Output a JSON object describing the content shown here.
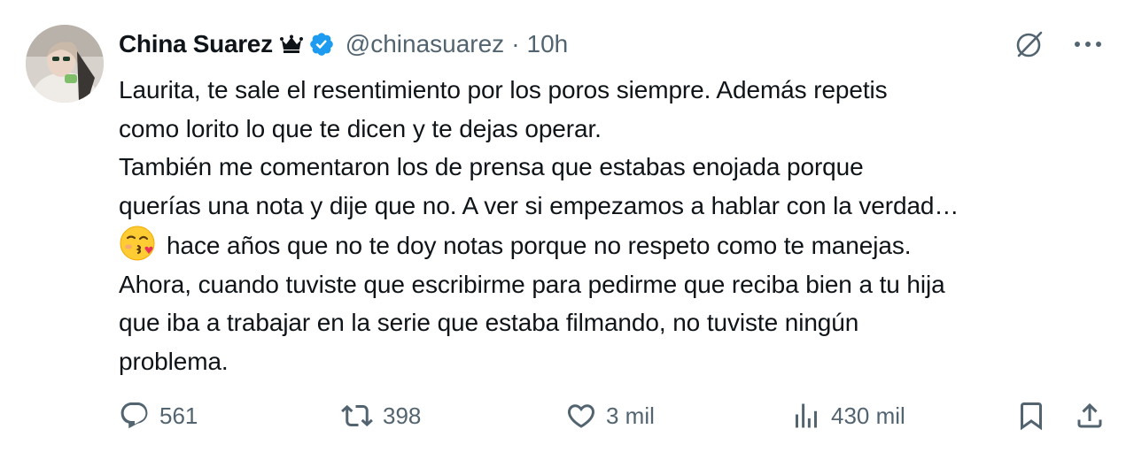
{
  "author": {
    "display_name": "China Suarez",
    "handle": "@chinasuarez",
    "separator": "·",
    "time": "10h",
    "badge_color": "#1d9bf0"
  },
  "tweet": {
    "lines": [
      "Laurita, te sale el resentimiento por los poros siempre. Además repetis",
      "como lorito lo que te dicen y te dejas operar.",
      "También me comentaron los de prensa que estabas enojada porque",
      "querías una nota y dije que no. A ver si empezamos a hablar con la verdad…",
      "hace años que no te doy notas porque no respeto como te manejas.",
      "Ahora, cuando tuviste que escribirme para pedirme que reciba bien a tu hija",
      "que iba a trabajar en la serie que estaba filmando, no tuviste ningún",
      "problema."
    ],
    "emoji": "face-blowing-kiss"
  },
  "actions": {
    "replies": "561",
    "reposts": "398",
    "likes": "3 mil",
    "views": "430 mil"
  },
  "icons": {
    "crown": "crown-icon",
    "verified": "verified-badge-icon",
    "grok": "grok-icon",
    "more": "more-icon",
    "reply": "reply-icon",
    "repost": "repost-icon",
    "like": "heart-icon",
    "views": "views-icon",
    "bookmark": "bookmark-icon",
    "share": "share-icon"
  },
  "colors": {
    "text": "#0f1419",
    "secondary": "#536471",
    "accent": "#1d9bf0"
  }
}
